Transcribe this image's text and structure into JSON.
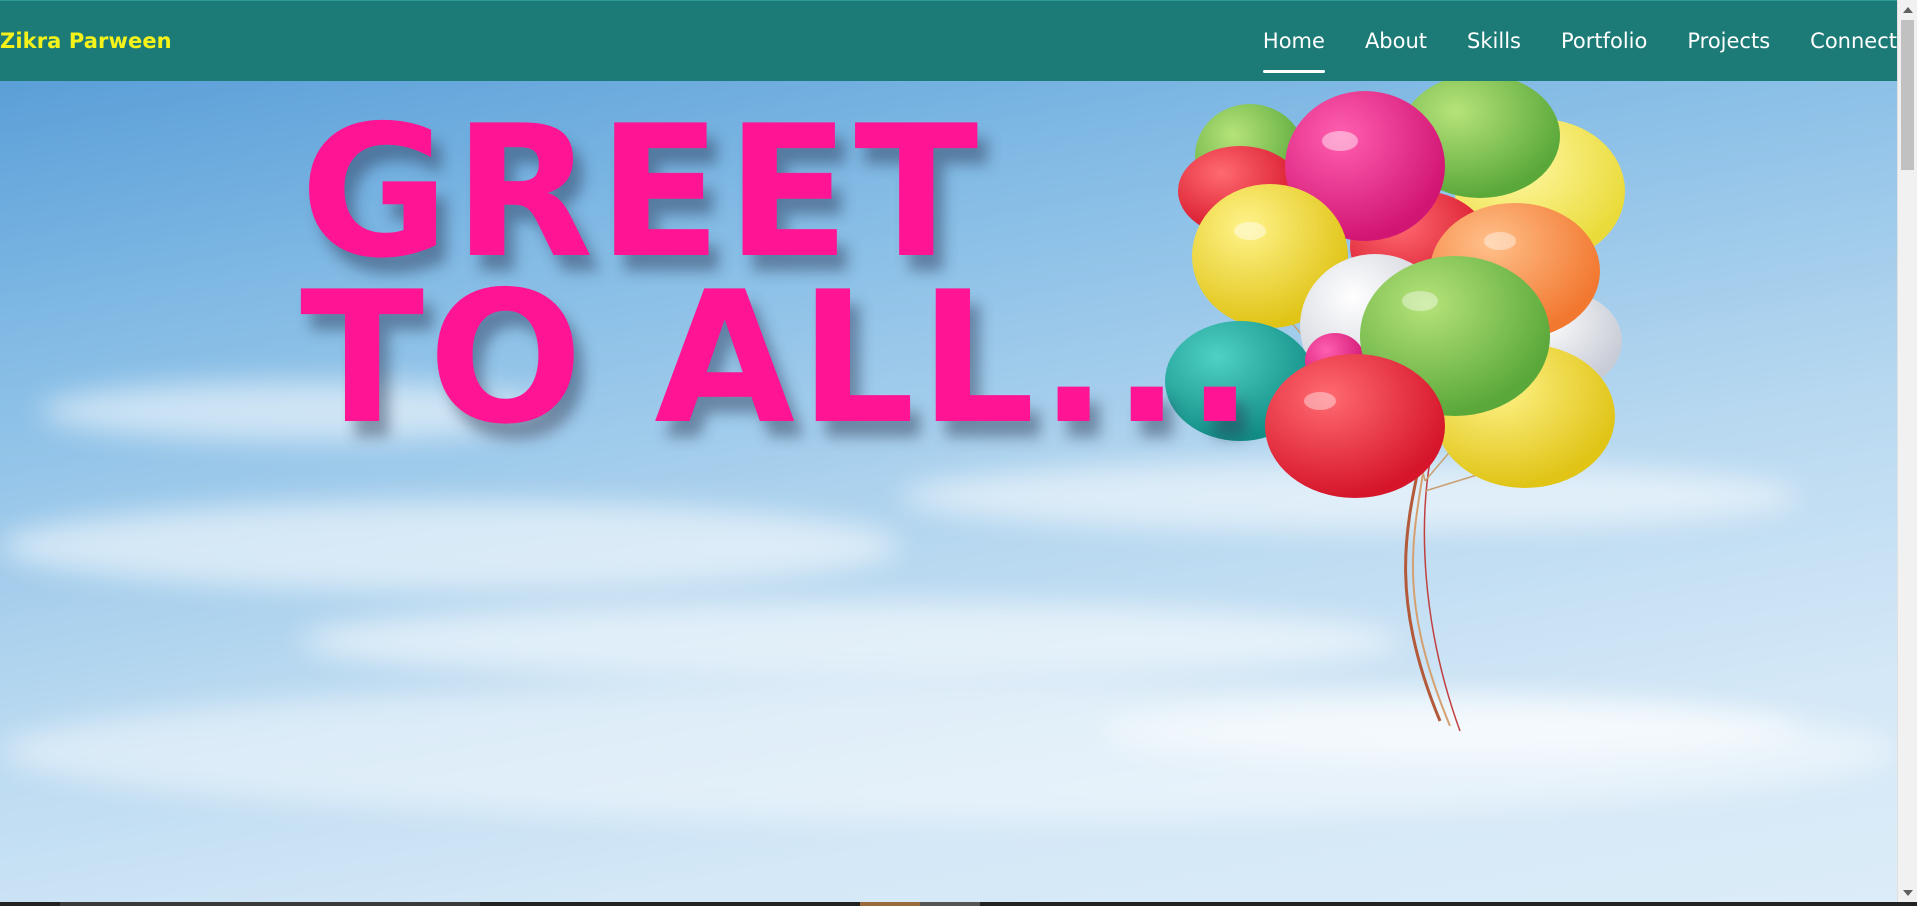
{
  "brand": {
    "name": "Zikra Parween",
    "color": "#f5f21a"
  },
  "nav": {
    "background": "#1d7b77",
    "items": [
      {
        "label": "Home",
        "active": true
      },
      {
        "label": "About",
        "active": false
      },
      {
        "label": "Skills",
        "active": false
      },
      {
        "label": "Portfolio",
        "active": false
      },
      {
        "label": "Projects",
        "active": false
      },
      {
        "label": "Connect",
        "active": false
      }
    ]
  },
  "hero": {
    "line1": "GREET",
    "line2": "TO ALL...",
    "text_color": "#ff1493",
    "image": "balloons-in-sky"
  },
  "icons": {
    "scroll_up": "chevron-up-icon",
    "scroll_down": "chevron-down-icon"
  }
}
